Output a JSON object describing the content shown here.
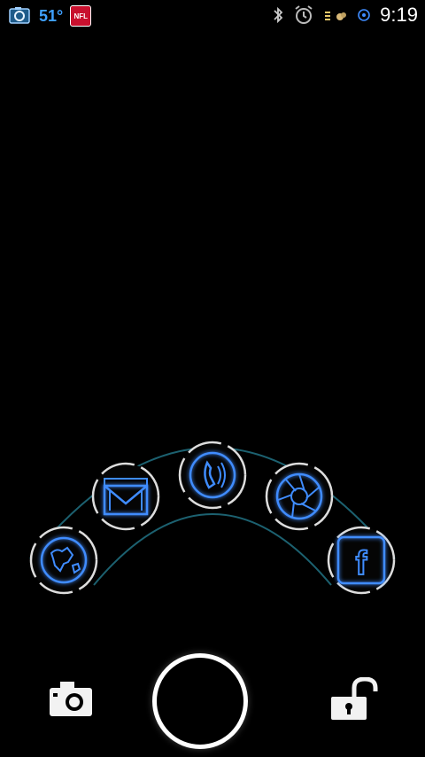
{
  "status_bar": {
    "left_icons": [
      "camera-notification-icon",
      "weather-icon",
      "nfl-icon"
    ],
    "temperature": "51°",
    "nfl_label": "NFL",
    "right_icons": [
      "bluetooth-icon",
      "alarm-icon",
      "battery-icon",
      "sync-icon"
    ],
    "time": "9:19"
  },
  "lockscreen": {
    "apps": [
      {
        "name": "browser",
        "icon": "globe-icon"
      },
      {
        "name": "gmail",
        "icon": "mail-icon"
      },
      {
        "name": "phone",
        "icon": "phone-icon"
      },
      {
        "name": "camera-app",
        "icon": "aperture-icon"
      },
      {
        "name": "facebook",
        "icon": "facebook-icon",
        "label": "f"
      }
    ],
    "bottom": {
      "camera_icon": "camera-icon",
      "shutter": "lock-ring-button",
      "unlock_icon": "unlock-icon"
    }
  },
  "colors": {
    "neon_blue": "#3f8cff",
    "arc_teal": "#1f6b7c",
    "background": "#000000"
  }
}
